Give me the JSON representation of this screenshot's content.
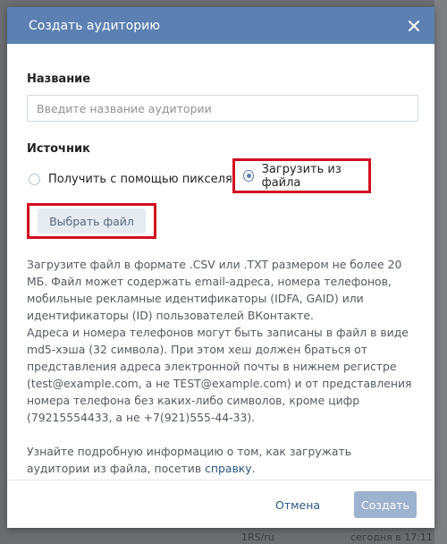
{
  "modal": {
    "title": "Создать аудиторию",
    "close_icon": "close-icon"
  },
  "name_field": {
    "label": "Название",
    "placeholder": "Введите название аудитории",
    "value": ""
  },
  "source": {
    "label": "Источник",
    "options": [
      {
        "label": "Получить с помощью пикселя",
        "selected": false
      },
      {
        "label": "Загрузить из файла",
        "selected": true
      }
    ],
    "choose_file_label": "Выбрать файл"
  },
  "description": {
    "paragraph1": "Загрузите файл в формате .CSV или .TXT размером не более 20 МБ. Файл может содержать email-адреса, номера телефонов, мобильные рекламные идентификаторы (IDFA, GAID) или идентификаторы (ID) пользователей ВКонтакте.",
    "paragraph2": "Адреса и номера телефонов могут быть записаны в файл в виде md5-хэша (32 символа). При этом хеш должен браться от представления адреса электронной почты в нижнем регистре (test@example.com, а не TEST@example.com) и от представления номера телефона без каких-либо символов, кроме цифр (79215554433, а не +7(921)555-44-33).",
    "help_prefix": "Узнайте подробную информацию о том, как загружать аудитории из файла, посетив",
    "help_link": "справку",
    "help_suffix": "."
  },
  "footer": {
    "cancel_label": "Отмена",
    "create_label": "Создать"
  },
  "backdrop": {
    "text_left": "1RS/ru",
    "text_right": "сегодня в 17:11"
  },
  "colors": {
    "header": "#5b80b1",
    "link": "#2a5885",
    "primary_disabled": "#9db2cf",
    "highlight": "#d10f1f"
  }
}
